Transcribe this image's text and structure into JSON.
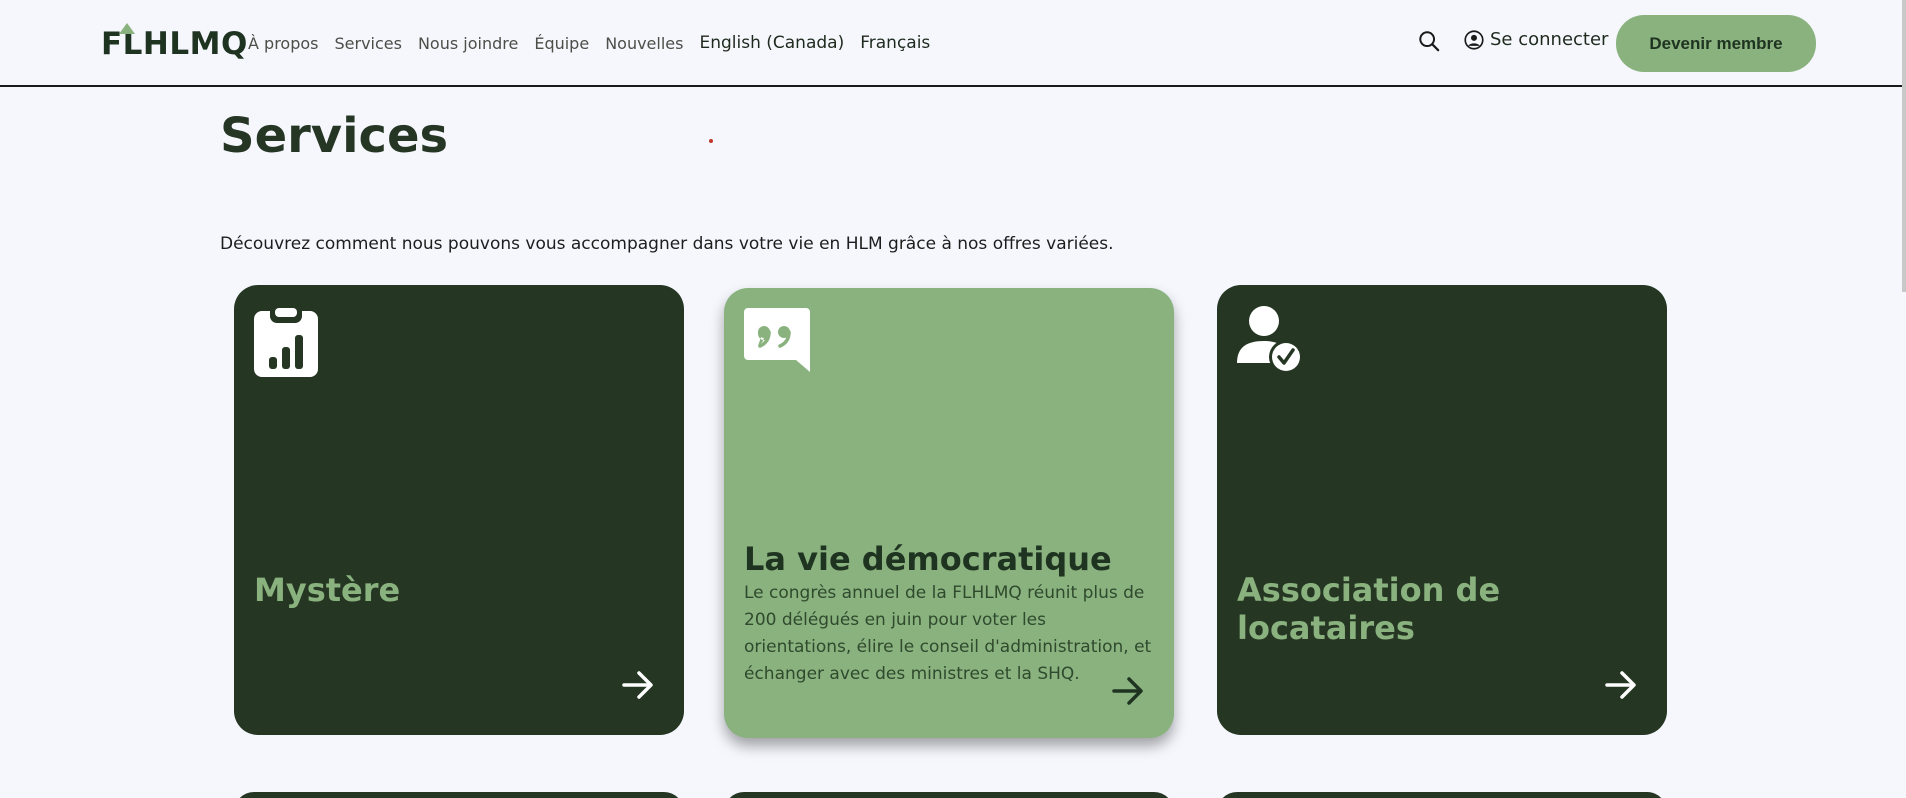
{
  "header": {
    "logo_text": "FLHLMQ",
    "nav": [
      {
        "label": "À propos"
      },
      {
        "label": "Services"
      },
      {
        "label": "Nous joindre"
      },
      {
        "label": "Équipe"
      },
      {
        "label": "Nouvelles"
      },
      {
        "label": "English (Canada)"
      },
      {
        "label": "Français"
      }
    ],
    "login_label": "Se connecter",
    "cta_label": "Devenir membre"
  },
  "main": {
    "title": "Services",
    "intro": "Découvrez comment nous pouvons vous accompagner dans votre vie en HLM grâce à nos offres variées.",
    "cards": [
      {
        "title": "Mystère",
        "icon": "clipboard-chart-icon"
      },
      {
        "title": "La vie démocratique",
        "icon": "quote-bubble-icon",
        "description": "Le congrès annuel de la FLHLMQ réunit plus de 200 délégués en juin pour voter les orientations, élire le conseil d'administration, et échanger avec des ministres et la SHQ."
      },
      {
        "title": "Association de locataires",
        "icon": "user-check-icon"
      }
    ]
  },
  "colors": {
    "background": "#f5f7fd",
    "dark_green": "#253623",
    "light_green": "#8ab27f"
  }
}
